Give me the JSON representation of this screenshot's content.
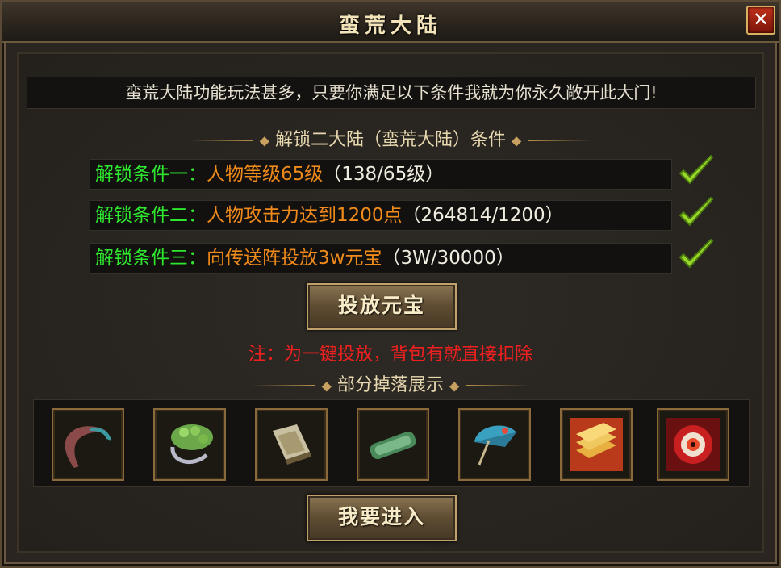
{
  "window": {
    "title": "蛮荒大陆",
    "close_label": "✕"
  },
  "intro": "蛮荒大陆功能玩法甚多，只要你满足以下条件我就为你永久敞开此大门!",
  "unlock_section": {
    "header": "解锁二大陆（蛮荒大陆）条件",
    "conditions": [
      {
        "label": "解锁条件一：",
        "requirement": "人物等级65级",
        "progress": "（138/65级）",
        "met": true
      },
      {
        "label": "解锁条件二：",
        "requirement": "人物攻击力达到1200点",
        "progress": "（264814/1200）",
        "met": true
      },
      {
        "label": "解锁条件三：",
        "requirement": "向传送阵投放3w元宝",
        "progress": "（3W/30000）",
        "met": true
      }
    ]
  },
  "deposit_button": "投放元宝",
  "note": "注：为一键投放，背包有就直接扣除",
  "drops_section": {
    "header": "部分掉落展示",
    "items": [
      {
        "icon": "ribbon-sash-icon"
      },
      {
        "icon": "jade-bracelet-icon"
      },
      {
        "icon": "book-scroll-icon"
      },
      {
        "icon": "jade-scroll-icon"
      },
      {
        "icon": "umbrella-icon"
      },
      {
        "icon": "gold-ingots-icon"
      },
      {
        "icon": "red-eye-orb-icon"
      }
    ]
  },
  "enter_button": "我要进入",
  "colors": {
    "condition_label": "#2ee82e",
    "condition_requirement": "#f08a1a",
    "note": "#f02020",
    "check": "#9ad82a"
  }
}
